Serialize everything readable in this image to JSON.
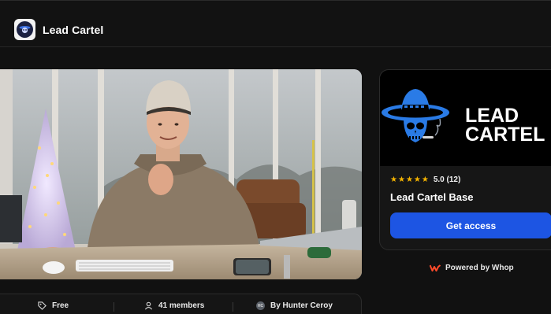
{
  "header": {
    "brand_name": "Lead Cartel"
  },
  "hero": {
    "media": "video-thumbnail"
  },
  "stats": {
    "price": "Free",
    "members": "41 members",
    "author_initials": "HC",
    "author": "By Hunter Ceroy"
  },
  "card": {
    "banner_line1": "LEAD",
    "banner_line2": "CARTEL",
    "rating": "5.0 (12)",
    "product_name": "Lead Cartel Base",
    "cta_label": "Get access"
  },
  "footer": {
    "powered_by": "Powered by Whop"
  },
  "colors": {
    "accent": "#1d55e3",
    "star": "#f5b400",
    "logo_blue": "#2a7be6",
    "whop_red": "#ff4a2a"
  }
}
